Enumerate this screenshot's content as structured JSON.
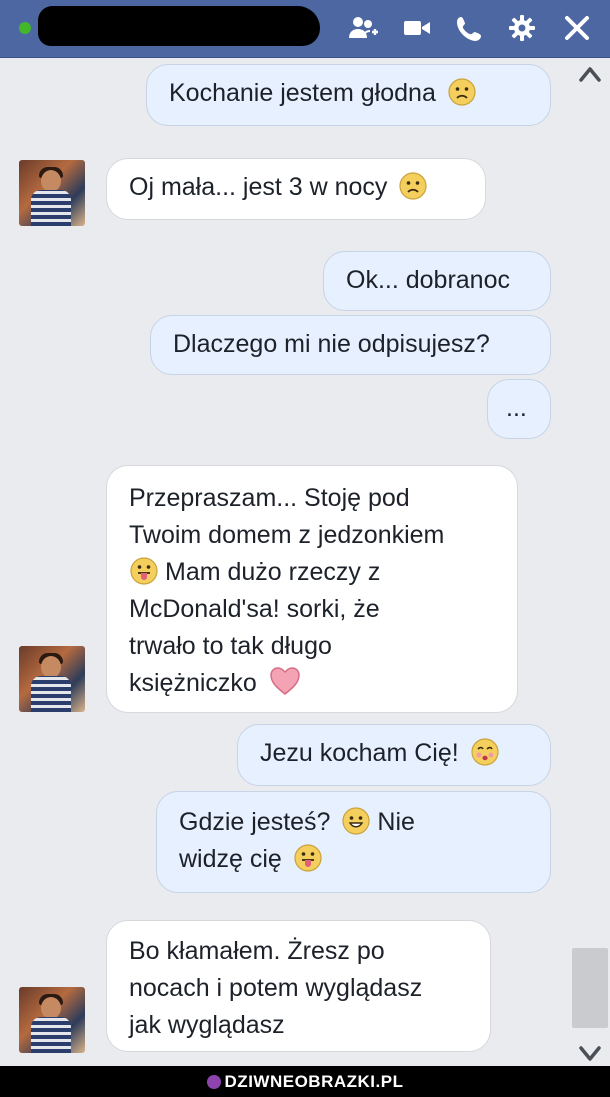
{
  "titlebar": {
    "contact_name_hidden": true,
    "icons": [
      "add-person-icon",
      "video-camera-icon",
      "phone-icon",
      "gear-icon",
      "close-icon"
    ],
    "color": "#4c67a1",
    "online_color": "#42b72a"
  },
  "messages": [
    {
      "side": "me",
      "text": "Kochanie jestem głodna",
      "emoji": "sad-face-emoji"
    },
    {
      "side": "them",
      "text": "Oj mała... jest 3 w nocy",
      "emoji": "sad-face-emoji"
    },
    {
      "side": "me",
      "text": "Ok... dobranoc"
    },
    {
      "side": "me",
      "text": "Dlaczego mi nie odpisujesz?"
    },
    {
      "side": "me",
      "text": "..."
    },
    {
      "side": "them",
      "line1": "Przepraszam... Stoję pod",
      "line2": "Twoim domem z jedzonkiem",
      "line3": "Mam dużo rzeczy z",
      "line4": "McDonald'sa! sorki, że",
      "line5": "trwało to tak długo",
      "line6": "księżniczko",
      "emojis": [
        "tongue-face-emoji",
        "heart-emoji"
      ]
    },
    {
      "side": "me",
      "text": "Jezu kocham Cię!",
      "emoji": "kiss-face-emoji"
    },
    {
      "side": "me",
      "line1": "Gdzie jesteś?",
      "line1b": "Nie",
      "line2": "widzę cię",
      "emojis": [
        "smile-face-emoji",
        "tongue-face-emoji"
      ]
    },
    {
      "side": "them",
      "line1": "Bo kłamałem. Żresz po",
      "line2": "nocach i potem wyglądasz",
      "line3": "jak wyglądasz"
    }
  ],
  "colors": {
    "my_bubble": "#e6f0fe",
    "their_bubble": "#ffffff",
    "background": "#e9ebee"
  },
  "watermark": "DZIWNEOBRAZKI.PL"
}
